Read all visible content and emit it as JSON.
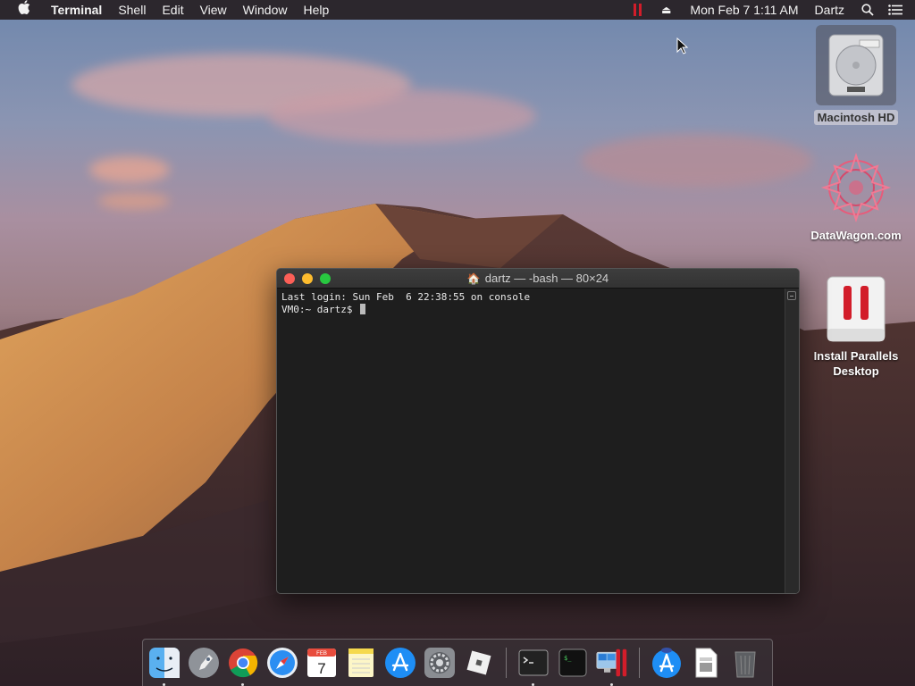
{
  "menubar": {
    "app_name": "Terminal",
    "menus": [
      "Shell",
      "Edit",
      "View",
      "Window",
      "Help"
    ],
    "datetime": "Mon Feb 7  1:11 AM",
    "user": "Dartz",
    "icons": [
      "apple-icon",
      "parallels-icon",
      "eject-icon",
      "search-icon",
      "notification-list-icon"
    ]
  },
  "desktop_icons": [
    {
      "name": "macintosh-hd",
      "label": "Macintosh HD",
      "icon": "hard-drive-icon"
    },
    {
      "name": "datawagon",
      "label": "DataWagon.com",
      "icon": "datawagon-logo-icon"
    },
    {
      "name": "install-parallels",
      "label": "Install Parallels Desktop",
      "icon": "parallels-installer-icon"
    }
  ],
  "terminal": {
    "title": "dartz — -bash — 80×24",
    "lines": [
      "Last login: Sun Feb  6 22:38:55 on console",
      "VM0:~ dartz$ "
    ]
  },
  "dock": {
    "items": [
      {
        "name": "finder",
        "icon": "finder-icon",
        "running": true
      },
      {
        "name": "launchpad",
        "icon": "launchpad-icon",
        "running": false
      },
      {
        "name": "chrome",
        "icon": "chrome-icon",
        "running": true
      },
      {
        "name": "safari",
        "icon": "safari-icon",
        "running": false
      },
      {
        "name": "calendar",
        "icon": "calendar-icon",
        "running": false,
        "month": "FEB",
        "day": "7"
      },
      {
        "name": "notes",
        "icon": "notes-icon",
        "running": false
      },
      {
        "name": "app-store",
        "icon": "app-store-icon",
        "running": false
      },
      {
        "name": "system-preferences",
        "icon": "system-preferences-icon",
        "running": false
      },
      {
        "name": "roblox",
        "icon": "roblox-icon",
        "running": false
      },
      {
        "name": "terminal-app",
        "icon": "terminal-icon",
        "running": true
      },
      {
        "name": "activity-terminal",
        "icon": "console-icon",
        "running": false
      },
      {
        "name": "parallels-desktop",
        "icon": "parallels-desktop-icon",
        "running": true
      },
      {
        "name": "app-store-downloads",
        "icon": "app-store-downloads-icon",
        "running": false
      },
      {
        "name": "documents",
        "icon": "documents-icon",
        "running": false
      },
      {
        "name": "trash",
        "icon": "trash-icon",
        "running": false
      }
    ]
  },
  "colors": {
    "terminal_bg": "#1e1e1e",
    "close": "#fc5f57",
    "minimize": "#fdbc2e",
    "maximize": "#28c840",
    "parallels_red": "#d21d2a"
  }
}
